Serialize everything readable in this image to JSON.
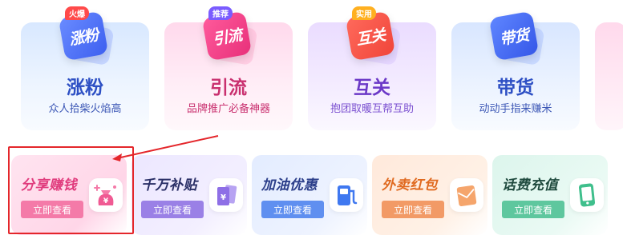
{
  "feature_cards": [
    {
      "title": "涨粉",
      "subtitle": "众人拾柴火焰高",
      "icon_text": "涨粉",
      "badge": "火爆",
      "icon": "growth-tile-icon"
    },
    {
      "title": "引流",
      "subtitle": "品牌推广必备神器",
      "icon_text": "引流",
      "badge": "推荐",
      "icon": "traffic-tile-icon"
    },
    {
      "title": "互关",
      "subtitle": "抱团取暖互帮互助",
      "icon_text": "互关",
      "badge": "实用",
      "icon": "mutual-follow-tile-icon"
    },
    {
      "title": "带货",
      "subtitle": "动动手指来赚米",
      "icon_text": "带货",
      "badge": "",
      "icon": "sales-tile-icon"
    }
  ],
  "service_cards": [
    {
      "title": "分享赚钱",
      "button": "立即查看",
      "icon": "money-bag-icon"
    },
    {
      "title": "千万补贴",
      "button": "立即查看",
      "icon": "subsidy-cards-icon"
    },
    {
      "title": "加油优惠",
      "button": "立即查看",
      "icon": "fuel-pump-icon"
    },
    {
      "title": "外卖红包",
      "button": "立即查看",
      "icon": "red-envelope-icon"
    },
    {
      "title": "话费充值",
      "button": "立即查看",
      "icon": "phone-icon"
    }
  ],
  "annotation": {
    "color": "#e4262b"
  },
  "colors": {
    "pink": "#f47aa8",
    "purple": "#9a80e6",
    "blue": "#5f8ff0",
    "orange": "#f29a66",
    "green": "#5ec79e"
  }
}
